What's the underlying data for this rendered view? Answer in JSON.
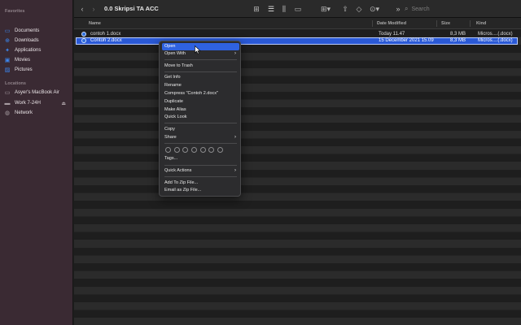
{
  "sidebar": {
    "favorites_heading": "Favorites",
    "favorites": [
      {
        "label": "Documents",
        "icon": "document-icon"
      },
      {
        "label": "Downloads",
        "icon": "download-icon"
      },
      {
        "label": "Applications",
        "icon": "applications-icon"
      },
      {
        "label": "Movies",
        "icon": "movies-icon"
      },
      {
        "label": "Pictures",
        "icon": "pictures-icon"
      }
    ],
    "locations_heading": "Locations",
    "locations": [
      {
        "label": "Asyer's MacBook Air",
        "icon": "laptop-icon"
      },
      {
        "label": "Work 7-24H",
        "icon": "drive-icon"
      },
      {
        "label": "Network",
        "icon": "network-icon"
      }
    ]
  },
  "toolbar": {
    "title": "0.0 Skripsi TA ACC",
    "search_placeholder": "Search"
  },
  "columns": {
    "name": "Name",
    "date_modified": "Date Modified",
    "size": "Size",
    "kind": "Kind"
  },
  "files": [
    {
      "name": "contoh 1.docx",
      "date": "Today 11.47",
      "size": "8,3 MB",
      "kind": "Micros....(.docx)"
    },
    {
      "name": "Contoh 2.docx",
      "date": "15 December 2021 15.09",
      "size": "8,3 MB",
      "kind": "Micros....(.docx)"
    }
  ],
  "context_menu": {
    "open": "Open",
    "open_with": "Open With",
    "move_to_trash": "Move to Trash",
    "get_info": "Get Info",
    "rename": "Rename",
    "compress": "Compress \"Contoh 2.docx\"",
    "duplicate": "Duplicate",
    "make_alias": "Make Alias",
    "quick_look": "Quick Look",
    "copy": "Copy",
    "share": "Share",
    "tags": "Tags...",
    "quick_actions": "Quick Actions",
    "add_to_zip": "Add To Zip File...",
    "email_as_zip": "Email as Zip File..."
  },
  "colors": {
    "selection": "#2a59d6",
    "menu_highlight": "#2f62e0",
    "sidebar_bg": "#3a2a33",
    "accent": "#3c87f0"
  }
}
